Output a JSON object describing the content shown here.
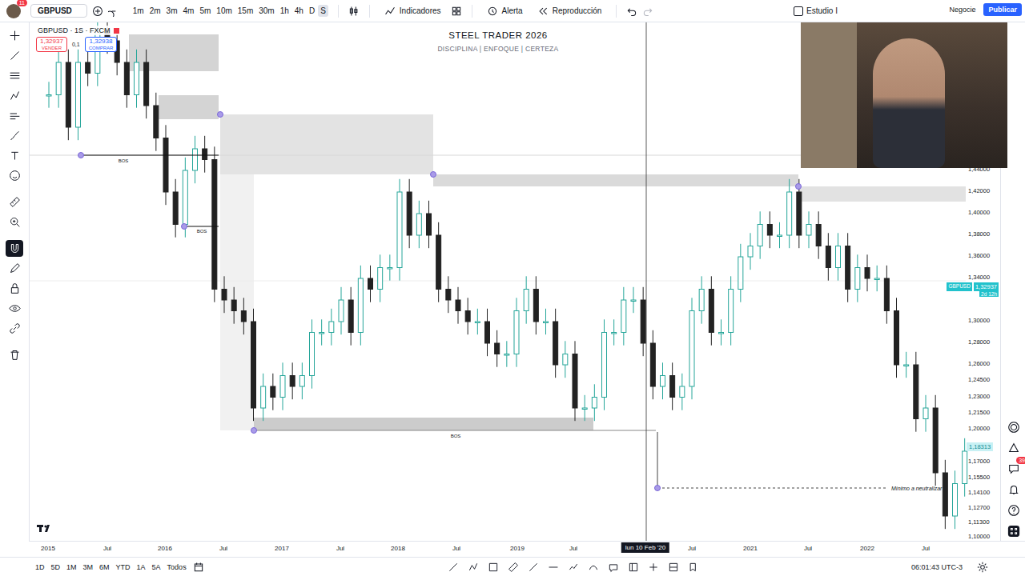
{
  "top_bar": {
    "avatar_badge": "11",
    "symbol": "GBPUSD",
    "timeframes": [
      {
        "label": "1m",
        "selected": false
      },
      {
        "label": "2m",
        "selected": false
      },
      {
        "label": "3m",
        "selected": false
      },
      {
        "label": "4m",
        "selected": false
      },
      {
        "label": "5m",
        "selected": false
      },
      {
        "label": "10m",
        "selected": false
      },
      {
        "label": "15m",
        "selected": false
      },
      {
        "label": "30m",
        "selected": false
      },
      {
        "label": "1h",
        "selected": false
      },
      {
        "label": "4h",
        "selected": false
      },
      {
        "label": "D",
        "selected": false
      },
      {
        "label": "S",
        "selected": true
      }
    ],
    "indicators": "Indicadores",
    "alert": "Alerta",
    "replay": "Reproducción",
    "study": "Estudio I",
    "study_checked": false,
    "trade": "Negocie",
    "publish": "Publicar"
  },
  "left_tools": [
    {
      "selected": false
    },
    {
      "selected": false
    },
    {
      "selected": false
    },
    {
      "selected": false
    },
    {
      "selected": false
    },
    {
      "selected": false
    },
    {
      "selected": false
    },
    {
      "selected": false
    },
    {
      "selected": false
    },
    {
      "selected": false
    },
    {
      "selected": true
    },
    {
      "selected": false
    },
    {
      "selected": false
    },
    {
      "selected": false
    },
    {
      "selected": false
    },
    {
      "selected": false
    }
  ],
  "legend": {
    "title": "GBPUSD · 1S · FXCM",
    "sell_price": "1,32937",
    "sell_label": "VENDER",
    "spread": "0,1",
    "buy_price": "1,32938",
    "buy_label": "COMPRAR"
  },
  "watermark": {
    "title": "STEEL TRADER 2026",
    "subtitle": "DISCIPLINA | ENFOQUE | CERTEZA"
  },
  "chart": {
    "series": [
      {
        "name": "GBPUSD",
        "closes": [
          1.51,
          1.54,
          1.48,
          1.54,
          1.53,
          1.57,
          1.56,
          1.54,
          1.51,
          1.54,
          1.5,
          1.47,
          1.42,
          1.39,
          1.44,
          1.46,
          1.45,
          1.33,
          1.32,
          1.31,
          1.3,
          1.22,
          1.24,
          1.23,
          1.25,
          1.24,
          1.25,
          1.29,
          1.29,
          1.3,
          1.32,
          1.29,
          1.34,
          1.33,
          1.35,
          1.35,
          1.42,
          1.38,
          1.4,
          1.38,
          1.33,
          1.32,
          1.31,
          1.3,
          1.3,
          1.28,
          1.27,
          1.27,
          1.31,
          1.33,
          1.3,
          1.3,
          1.26,
          1.27,
          1.22,
          1.22,
          1.23,
          1.29,
          1.29,
          1.32,
          1.32,
          1.28,
          1.24,
          1.25,
          1.23,
          1.24,
          1.31,
          1.33,
          1.29,
          1.29,
          1.33,
          1.36,
          1.37,
          1.39,
          1.38,
          1.38,
          1.42,
          1.38,
          1.39,
          1.37,
          1.35,
          1.37,
          1.33,
          1.35,
          1.34,
          1.34,
          1.31,
          1.26,
          1.26,
          1.21,
          1.22,
          1.16,
          1.12,
          1.15,
          1.18
        ]
      }
    ],
    "bos_labels": [
      "BOS",
      "BOS",
      "BOS"
    ],
    "min_label": "Mínimo a neutralizar",
    "price_ticks": [
      "1,44000",
      "1,42000",
      "1,40000",
      "1,38000",
      "1,36000",
      "1,34000",
      "1,30000",
      "1,28000",
      "1,26000",
      "1,24500",
      "1,23000",
      "1,21500",
      "1,20000",
      "1,17000",
      "1,15500",
      "1,14100",
      "1,12700",
      "1,11300",
      "1,10000"
    ],
    "time_ticks": [
      "2015",
      "Jul",
      "2016",
      "Jul",
      "2017",
      "Jul",
      "2018",
      "Jul",
      "2019",
      "Jul",
      "Jul",
      "2021",
      "Jul",
      "2022",
      "Jul"
    ],
    "crosshair_date": "lun 10 Feb '20",
    "last_price": {
      "symbol": "GBPUSD",
      "price": "1,32937",
      "countdown": "2d 12h"
    },
    "marked_price": "1,18313"
  },
  "right_tools": {
    "badge": "39"
  },
  "bottom_bar": {
    "ranges": [
      "1D",
      "5D",
      "1M",
      "3M",
      "6M",
      "YTD",
      "1A",
      "5A",
      "Todos"
    ],
    "clock": "06:01:43 UTC-3"
  }
}
